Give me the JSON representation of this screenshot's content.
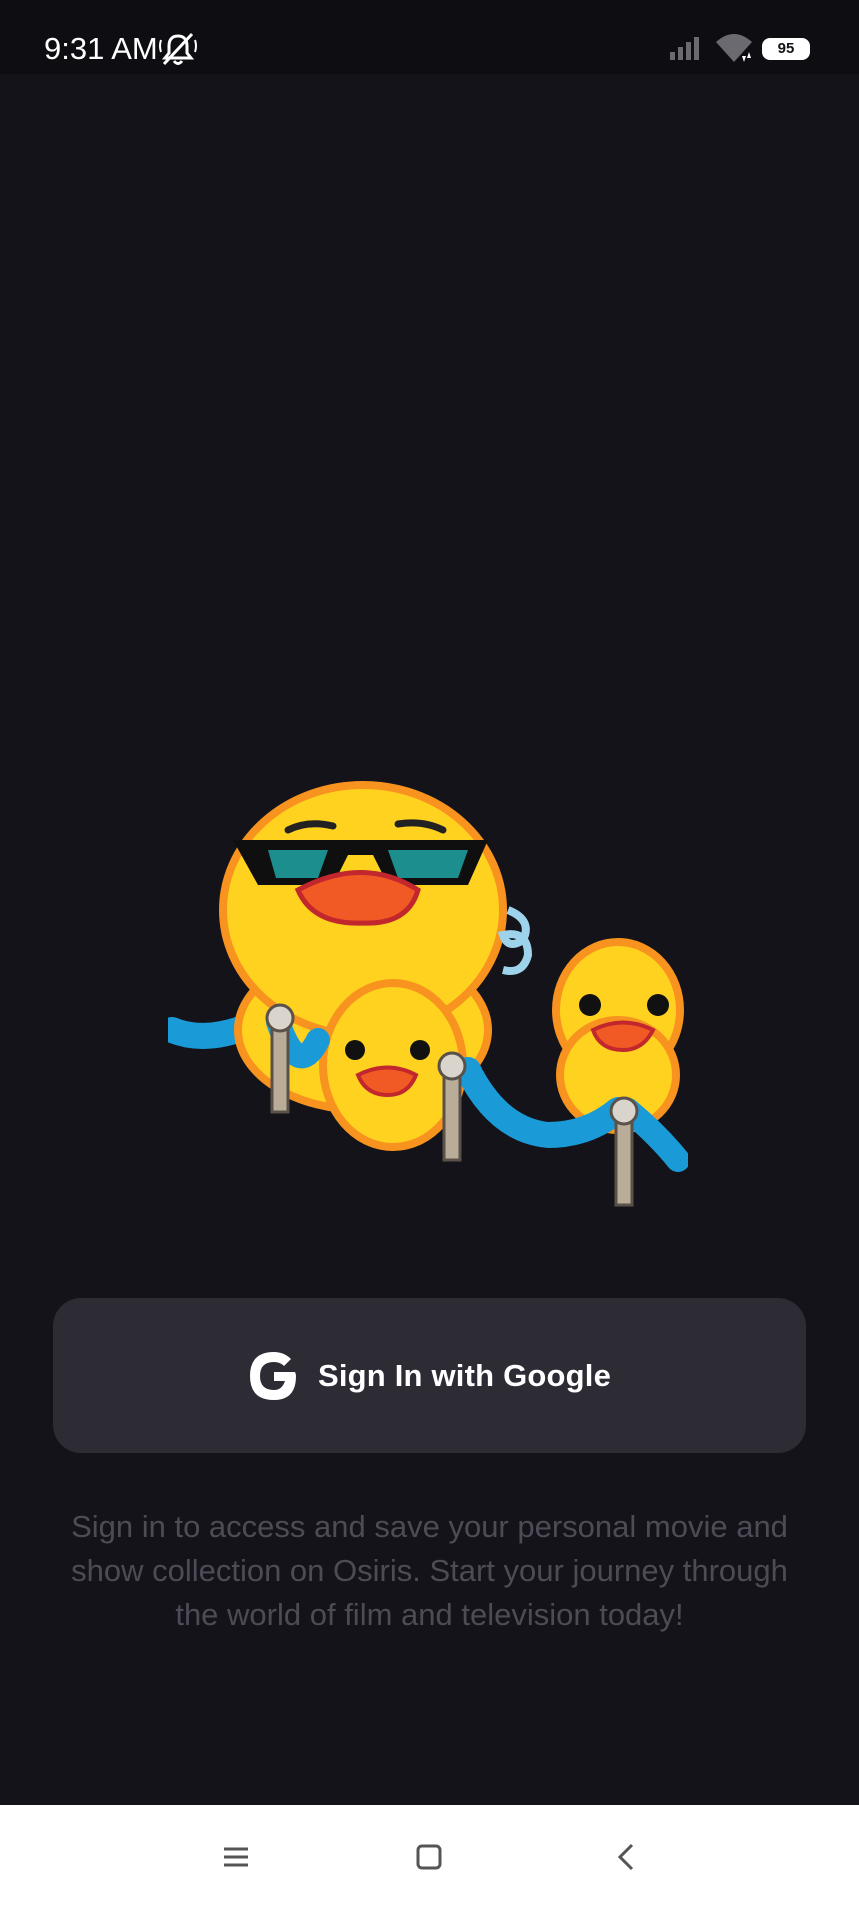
{
  "status_bar": {
    "time": "9:31 AM",
    "battery_level": "95",
    "icons": [
      "notifications-muted-icon",
      "signal-icon",
      "wifi-icon",
      "battery-icon"
    ]
  },
  "illustration": {
    "description_icon": "cool-ducks-velvet-rope-sticker"
  },
  "signin": {
    "button_label": "Sign In with Google",
    "icon": "google-icon"
  },
  "description": {
    "text": "Sign in to access and save your personal movie and show collection on Osiris. Start your journey through the world of film and television today!"
  },
  "nav_bar": {
    "icons": [
      "menu-icon",
      "home-icon",
      "back-icon"
    ]
  },
  "colors": {
    "background": "#141319",
    "button_background": "#2d2b33",
    "description_text": "#4d4b55",
    "duck_yellow": "#ffd21f",
    "duck_outline": "#f7931e",
    "rope_blue": "#1a9ad6"
  }
}
